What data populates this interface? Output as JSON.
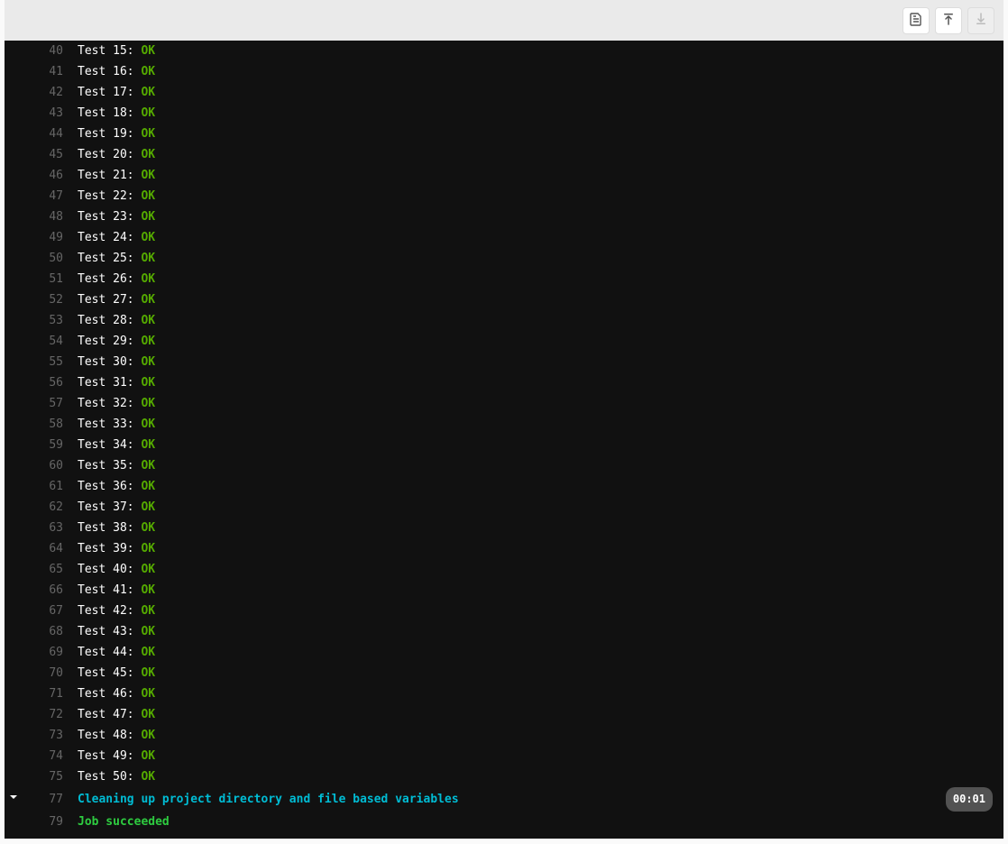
{
  "toolbar": {
    "raw_log": "Show complete raw log",
    "scroll_top": "Scroll to top",
    "scroll_bottom": "Scroll to bottom"
  },
  "lines": [
    {
      "num": "40",
      "test": "Test 15: ",
      "status": "OK"
    },
    {
      "num": "41",
      "test": "Test 16: ",
      "status": "OK"
    },
    {
      "num": "42",
      "test": "Test 17: ",
      "status": "OK"
    },
    {
      "num": "43",
      "test": "Test 18: ",
      "status": "OK"
    },
    {
      "num": "44",
      "test": "Test 19: ",
      "status": "OK"
    },
    {
      "num": "45",
      "test": "Test 20: ",
      "status": "OK"
    },
    {
      "num": "46",
      "test": "Test 21: ",
      "status": "OK"
    },
    {
      "num": "47",
      "test": "Test 22: ",
      "status": "OK"
    },
    {
      "num": "48",
      "test": "Test 23: ",
      "status": "OK"
    },
    {
      "num": "49",
      "test": "Test 24: ",
      "status": "OK"
    },
    {
      "num": "50",
      "test": "Test 25: ",
      "status": "OK"
    },
    {
      "num": "51",
      "test": "Test 26: ",
      "status": "OK"
    },
    {
      "num": "52",
      "test": "Test 27: ",
      "status": "OK"
    },
    {
      "num": "53",
      "test": "Test 28: ",
      "status": "OK"
    },
    {
      "num": "54",
      "test": "Test 29: ",
      "status": "OK"
    },
    {
      "num": "55",
      "test": "Test 30: ",
      "status": "OK"
    },
    {
      "num": "56",
      "test": "Test 31: ",
      "status": "OK"
    },
    {
      "num": "57",
      "test": "Test 32: ",
      "status": "OK"
    },
    {
      "num": "58",
      "test": "Test 33: ",
      "status": "OK"
    },
    {
      "num": "59",
      "test": "Test 34: ",
      "status": "OK"
    },
    {
      "num": "60",
      "test": "Test 35: ",
      "status": "OK"
    },
    {
      "num": "61",
      "test": "Test 36: ",
      "status": "OK"
    },
    {
      "num": "62",
      "test": "Test 37: ",
      "status": "OK"
    },
    {
      "num": "63",
      "test": "Test 38: ",
      "status": "OK"
    },
    {
      "num": "64",
      "test": "Test 39: ",
      "status": "OK"
    },
    {
      "num": "65",
      "test": "Test 40: ",
      "status": "OK"
    },
    {
      "num": "66",
      "test": "Test 41: ",
      "status": "OK"
    },
    {
      "num": "67",
      "test": "Test 42: ",
      "status": "OK"
    },
    {
      "num": "68",
      "test": "Test 43: ",
      "status": "OK"
    },
    {
      "num": "69",
      "test": "Test 44: ",
      "status": "OK"
    },
    {
      "num": "70",
      "test": "Test 45: ",
      "status": "OK"
    },
    {
      "num": "71",
      "test": "Test 46: ",
      "status": "OK"
    },
    {
      "num": "72",
      "test": "Test 47: ",
      "status": "OK"
    },
    {
      "num": "73",
      "test": "Test 48: ",
      "status": "OK"
    },
    {
      "num": "74",
      "test": "Test 49: ",
      "status": "OK"
    },
    {
      "num": "75",
      "test": "Test 50: ",
      "status": "OK"
    }
  ],
  "section": {
    "num": "77",
    "text": "Cleaning up project directory and file based variables",
    "duration": "00:01"
  },
  "final": {
    "num": "79",
    "text": "Job succeeded"
  }
}
